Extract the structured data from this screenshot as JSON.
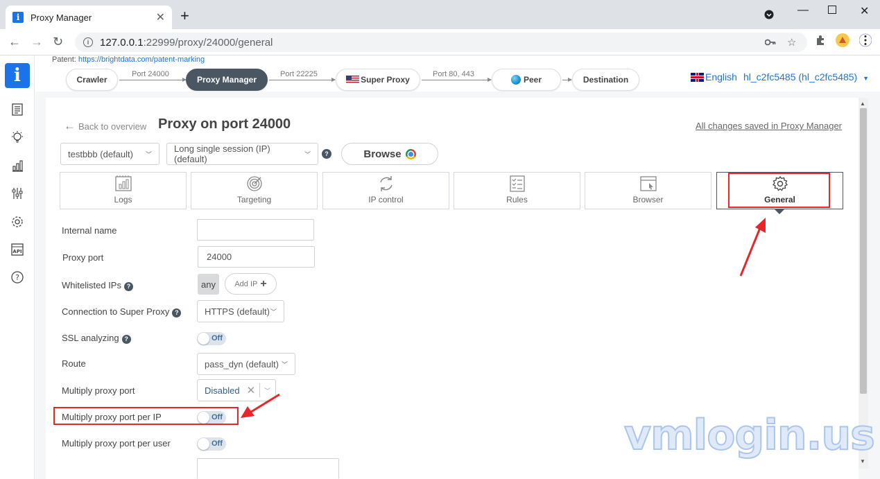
{
  "browser": {
    "tab_title": "Proxy Manager",
    "url_host": "127.0.0.1",
    "url_rest": ":22999/proxy/24000/general"
  },
  "pipeline": {
    "patent_label": "Patent:",
    "patent_link": "https://brightdata.com/patent-marking",
    "nodes": [
      "Crawler",
      "Proxy Manager",
      "Super Proxy",
      "Peer",
      "Destination"
    ],
    "ports": [
      "Port 24000",
      "Port 22225",
      "Port 80, 443"
    ]
  },
  "header": {
    "language": "English",
    "account": "hl_c2fc5485 (hl_c2fc5485)"
  },
  "proxy": {
    "back_label": "Back to overview",
    "title": "Proxy on port 24000",
    "saved_status": "All changes saved in Proxy Manager",
    "zone_select": "testbbb (default)",
    "preset_select": "Long single session (IP) (default)",
    "browse_label": "Browse"
  },
  "tabs": [
    "Logs",
    "Targeting",
    "IP control",
    "Rules",
    "Browser",
    "General"
  ],
  "form": {
    "internal_name_label": "Internal name",
    "internal_name_value": "",
    "proxy_port_label": "Proxy port",
    "proxy_port_value": "24000",
    "whitelisted_label": "Whitelisted IPs",
    "whitelisted_value": "any",
    "add_ip_label": "Add IP",
    "conn_label": "Connection to Super Proxy",
    "conn_value": "HTTPS (default)",
    "ssl_label": "SSL analyzing",
    "ssl_value": "Off",
    "route_label": "Route",
    "route_value": "pass_dyn (default)",
    "multiply_label": "Multiply proxy port",
    "multiply_value": "Disabled",
    "multiply_ip_label": "Multiply proxy port per IP",
    "multiply_ip_value": "Off",
    "multiply_user_label": "Multiply proxy port per user",
    "multiply_user_value": "Off"
  },
  "watermark": "vmlogin.us",
  "colors": {
    "accent": "#1a73e8",
    "active_node": "#4a5763",
    "highlight": "#e8262a"
  }
}
